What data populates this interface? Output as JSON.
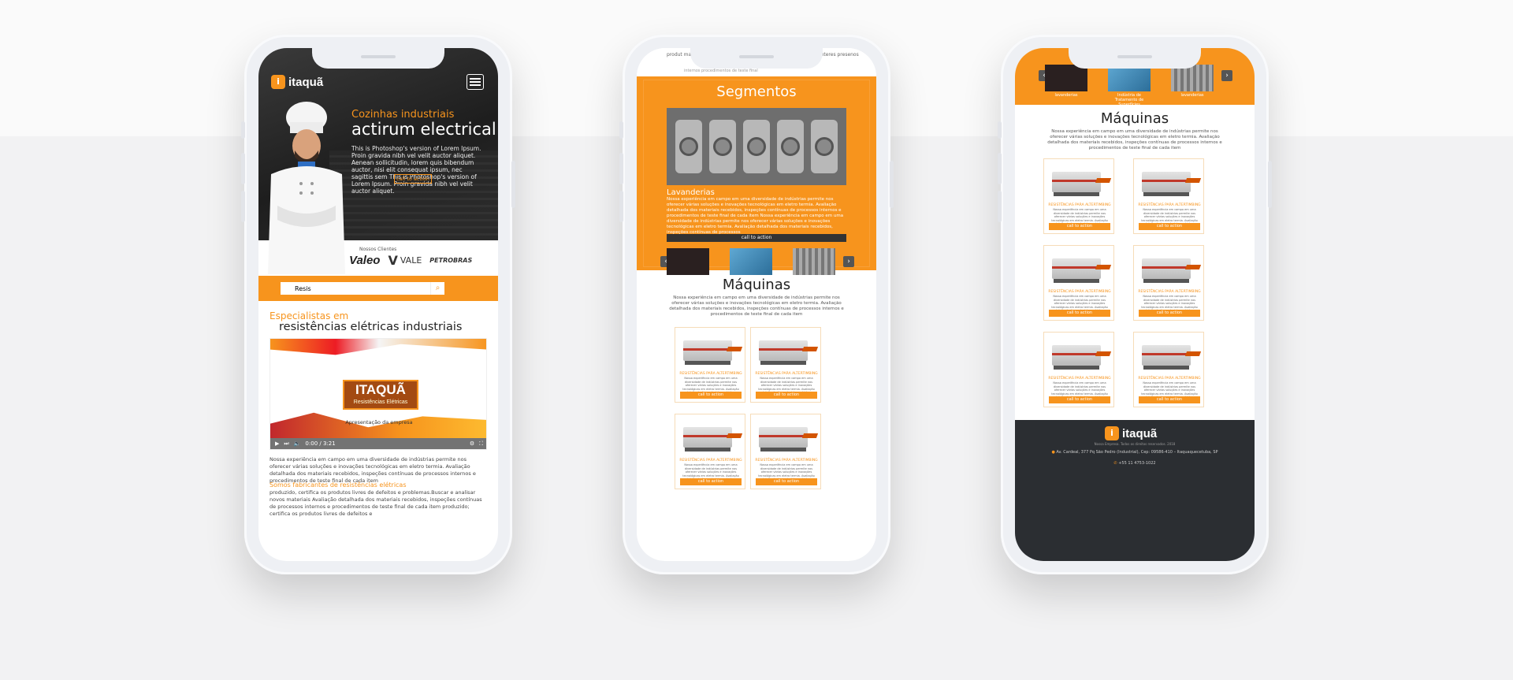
{
  "phone1": {
    "brand": "itaquã",
    "hero": {
      "eyebrow": "Cozinhas industriais",
      "title": "actirum electrical",
      "text": "This is Photoshop's version of Lorem Ipsum. Proin gravida nibh vel velit auctor aliquet. Aenean sollicitudin, lorem quis bibendum auctor, nisi elit consequat ipsum, nec sagittis sem This is Photoshop's version of Lorem Ipsum. Proin gravida nibh vel velit auctor aliquet.",
      "cta": "call to action"
    },
    "clients": {
      "label": "Nossos Clientes",
      "items": [
        "Valeo",
        "VALE",
        "PETROBRAS"
      ]
    },
    "search": {
      "value": "Resis"
    },
    "heading": {
      "small": "Especialistas em",
      "big": "resistências elétricas industriais"
    },
    "video": {
      "brand": "ITAQUÃ",
      "brand_sub": "Resistências Elétricas",
      "caption": "Apresentação da empresa",
      "time": "0:00 / 3:21"
    },
    "paragraph": "Nossa experiência em campo em uma diversidade de indústrias permite nos oferecer várias soluções e inovações tecnológicas em eletro termia. Avaliação detalhada dos materiais recebidos, inspeções contínuas de processos internos e procedimentos de teste final de cada item",
    "subheading": "Somos fabricantes de resistências elétricas",
    "paragraph2": "produzido, certifica os produtos livres de defeitos e problemas.Buscar e analisar novos materiais Avaliação detalhada dos materiais recebidos, inspeções contínuas de processos internos e procedimentos de teste final de cada item produzido; certifica os produtos livres de defeitos e"
  },
  "phone2": {
    "top_left": "produt materiais",
    "top_right": "i nteres presenos",
    "top_sub": "internos procedimentos de teste final",
    "segments_title": "Segmentos",
    "segment": {
      "title": "Lavanderias",
      "text": "Nossa experiência em campo em uma diversidade de indústrias permite nos oferecer várias soluções e inovações tecnológicas em eletro termia. Avaliação detalhada dos materiais recebidos, inspeções contínuas de processos internos e procedimentos de teste final de cada item Nossa experiência em campo em uma diversidade de indústrias permite nos oferecer várias soluções e inovações tecnológicas em eletro termia. Avaliação detalhada dos materiais recebidos, inspeções contínuas de processos",
      "cta": "call to action"
    },
    "thumbs": [
      "lavanderias",
      "Indústria de Tratamento de Superfícies",
      "lavanderias"
    ],
    "machines_title": "Máquinas",
    "machines_text": "Nossa experiência em campo em uma diversidade de indústrias permite nos oferecer várias soluções e inovações tecnológicas em eletro termia. Avaliação detalhada dos materiais recebidos, inspeções contínuas de processos internos e procedimentos de teste final de cada item",
    "card": {
      "title": "RESISTÊNCIAS PARA ALTERTIMBING",
      "text": "Nossa experiência em campo em uma diversidade de indústrias permite nos oferecer várias soluções e inovações tecnológicas em eletro termia. Avaliação detalhada dos materiais recebidos, inspeções contínuas de processos internos",
      "cta": "call to action"
    }
  },
  "phone3": {
    "thumbs": [
      "lavanderias",
      "Indústria de Tratamento de Superfícies",
      "lavanderias"
    ],
    "machines_title": "Máquinas",
    "machines_text": "Nossa experiência em campo em uma diversidade de indústrias permite nos oferecer várias soluções e inovações tecnológicas em eletro termia. Avaliação detalhada dos materiais recebidos, inspeções contínuas de processos internos e procedimentos de teste final de cada item",
    "card": {
      "title": "RESISTÊNCIAS PARA ALTERTIMBING",
      "text": "Nossa experiência em campo em uma diversidade de indústrias permite nos oferecer várias soluções e inovações tecnológicas em eletro termia. Avaliação detalhada dos materiais recebidos, inspeções contínuas de processos internos",
      "cta": "call to action"
    },
    "footer": {
      "brand": "itaquã",
      "tagline": "Nossa Empresa. Todos os direitos reservados. 2018",
      "address": "Av. Cardeal, 377 Pq São Pedro (Industrial), Cep: 09586-410 – Itaquaquecetuba, SP",
      "phone": "+55 11 4753-1022"
    }
  },
  "colors": {
    "accent": "#f7941d",
    "dark": "#2b2e32"
  },
  "icons": [
    "menu-icon",
    "search-icon",
    "play-icon",
    "chevron-left-icon",
    "chevron-right-icon",
    "phone-icon",
    "location-icon"
  ]
}
